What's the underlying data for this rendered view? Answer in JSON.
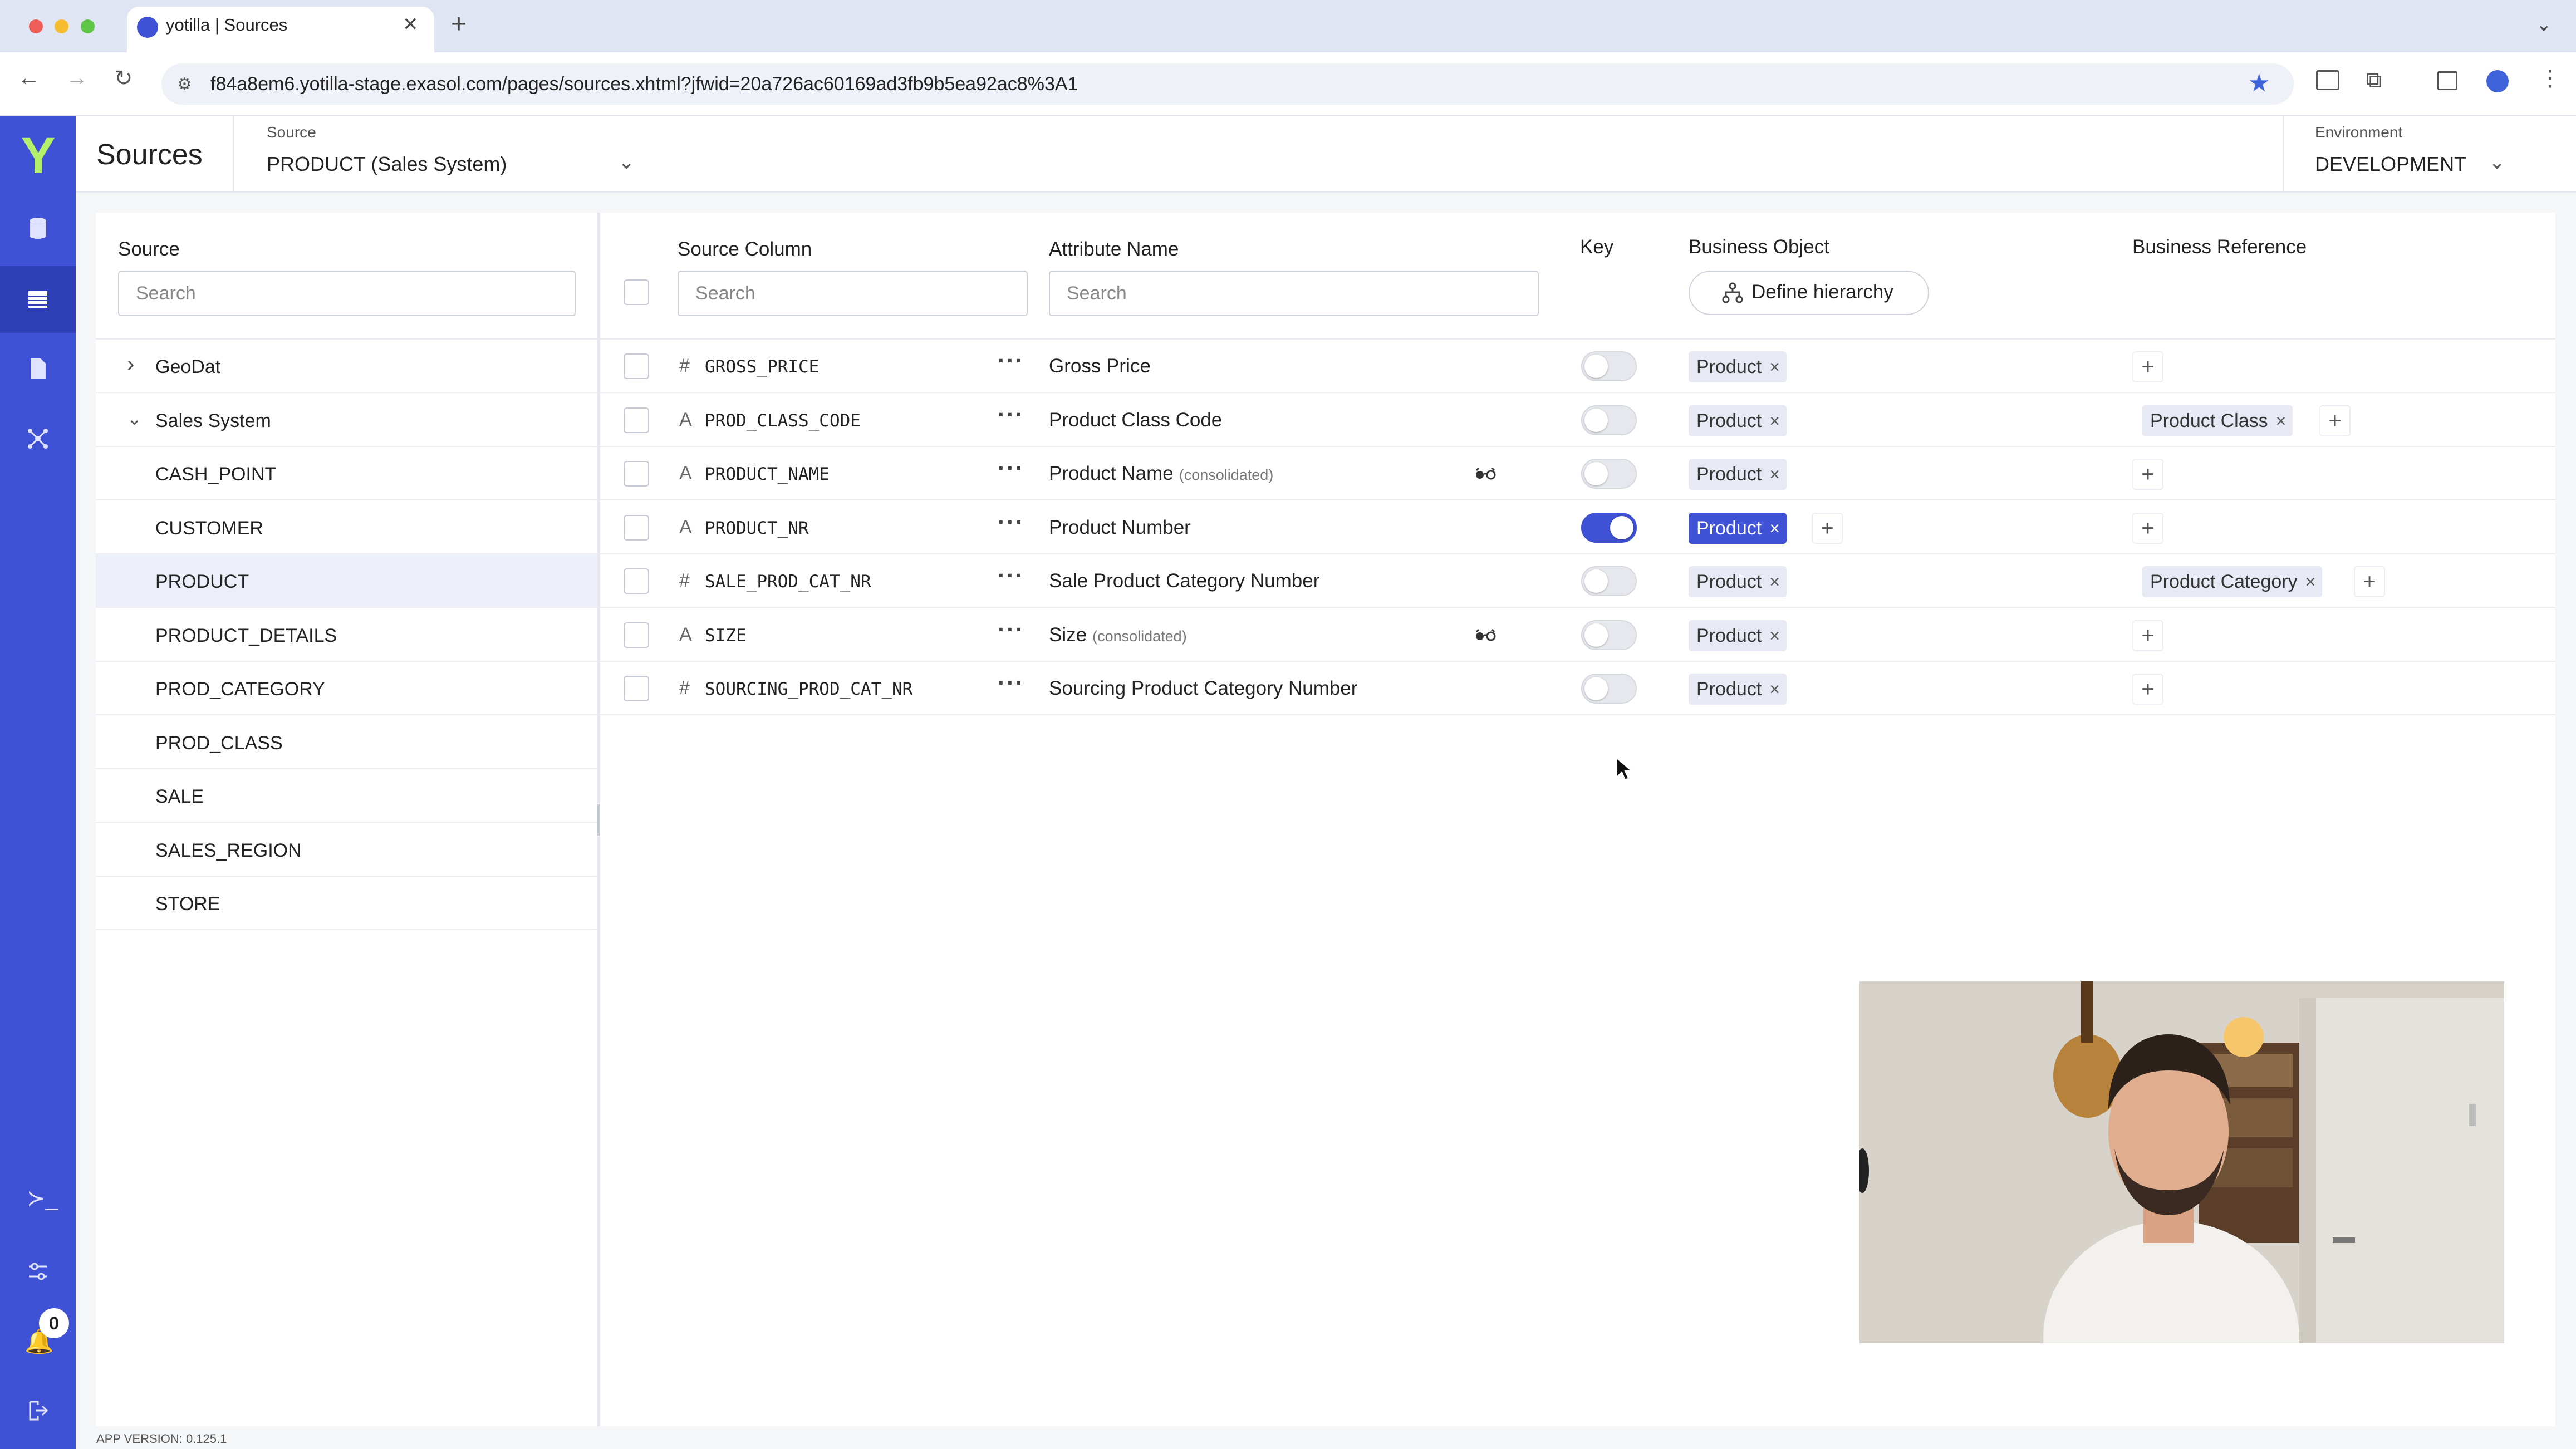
{
  "browser": {
    "tab_title": "yotilla | Sources",
    "url": "f84a8em6.yotilla-stage.exasol.com/pages/sources.xhtml?jfwid=20a726ac60169ad3fb9b5ea92ac8%3A1"
  },
  "rail": {
    "logo": "Y",
    "notification_count": "0",
    "icons": [
      "database-icon",
      "table-icon",
      "document-icon",
      "graph-icon",
      "terminal-icon",
      "settings-icon",
      "notification-icon",
      "logout-icon"
    ]
  },
  "header": {
    "title": "Sources",
    "source_label": "Source",
    "source_value": "PRODUCT (Sales System)",
    "env_label": "Environment",
    "env_value": "DEVELOPMENT"
  },
  "left_panel": {
    "header": "Source",
    "search_placeholder": "Search",
    "items": [
      {
        "label": "GeoDat",
        "expanded": false,
        "level": 0
      },
      {
        "label": "Sales System",
        "expanded": true,
        "level": 0
      },
      {
        "label": "CASH_POINT",
        "level": 1
      },
      {
        "label": "CUSTOMER",
        "level": 1
      },
      {
        "label": "PRODUCT",
        "level": 1,
        "selected": true
      },
      {
        "label": "PRODUCT_DETAILS",
        "level": 1
      },
      {
        "label": "PROD_CATEGORY",
        "level": 1
      },
      {
        "label": "PROD_CLASS",
        "level": 1
      },
      {
        "label": "SALE",
        "level": 1
      },
      {
        "label": "SALES_REGION",
        "level": 1
      },
      {
        "label": "STORE",
        "level": 1
      }
    ]
  },
  "table": {
    "headers": {
      "source_column": "Source Column",
      "attribute_name": "Attribute Name",
      "key": "Key",
      "business_object": "Business Object",
      "business_reference": "Business Reference"
    },
    "source_search_placeholder": "Search",
    "attribute_search_placeholder": "Search",
    "define_hierarchy_label": "Define hierarchy",
    "consolidated_label": "(consolidated)",
    "chip_close": "×",
    "plus": "+",
    "more": "···",
    "rows": [
      {
        "type": "#",
        "column": "GROSS_PRICE",
        "attribute": "Gross Price",
        "consolidated": false,
        "key": false,
        "business_object": "Product",
        "bo_active": false,
        "business_reference": ""
      },
      {
        "type": "A",
        "column": "PROD_CLASS_CODE",
        "attribute": "Product Class Code",
        "consolidated": false,
        "key": false,
        "business_object": "Product",
        "bo_active": false,
        "business_reference": "Product Class"
      },
      {
        "type": "A",
        "column": "PRODUCT_NAME",
        "attribute": "Product Name",
        "consolidated": true,
        "key": false,
        "business_object": "Product",
        "bo_active": false,
        "business_reference": ""
      },
      {
        "type": "A",
        "column": "PRODUCT_NR",
        "attribute": "Product Number",
        "consolidated": false,
        "key": true,
        "business_object": "Product",
        "bo_active": true,
        "business_reference": ""
      },
      {
        "type": "#",
        "column": "SALE_PROD_CAT_NR",
        "attribute": "Sale Product Category Number",
        "consolidated": false,
        "key": false,
        "business_object": "Product",
        "bo_active": false,
        "business_reference": "Product Category"
      },
      {
        "type": "A",
        "column": "SIZE",
        "attribute": "Size",
        "consolidated": true,
        "key": false,
        "business_object": "Product",
        "bo_active": false,
        "business_reference": ""
      },
      {
        "type": "#",
        "column": "SOURCING_PROD_CAT_NR",
        "attribute": "Sourcing Product Category Number",
        "consolidated": false,
        "key": false,
        "business_object": "Product",
        "bo_active": false,
        "business_reference": ""
      }
    ]
  },
  "footer": {
    "app_version": "APP VERSION: 0.125.1"
  },
  "colors": {
    "accent": "#3f51d4",
    "rail": "#3f51d4",
    "chip": "#e7eaf5"
  }
}
